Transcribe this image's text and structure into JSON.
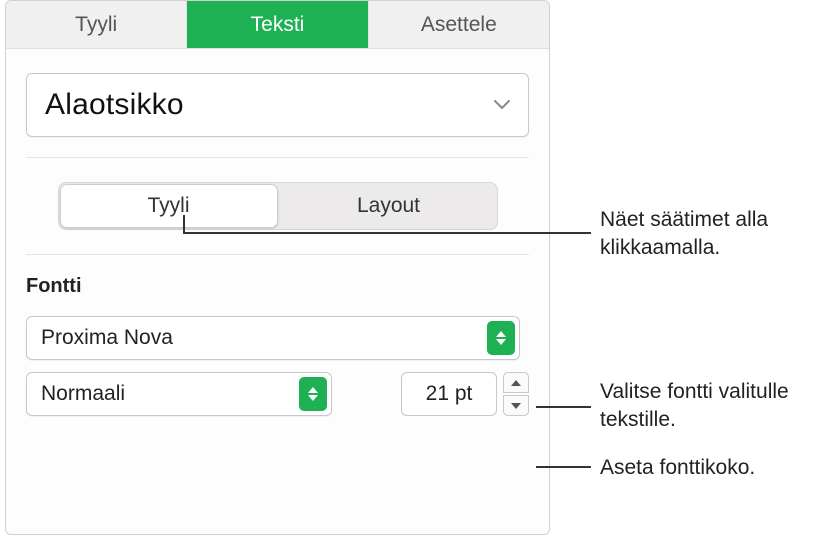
{
  "topTabs": {
    "style": "Tyyli",
    "text": "Teksti",
    "arrange": "Asettele"
  },
  "paragraphStyle": {
    "selected": "Alaotsikko"
  },
  "subTabs": {
    "style": "Tyyli",
    "layout": "Layout"
  },
  "fontSection": {
    "label": "Fontti",
    "family": "Proxima Nova",
    "styleName": "Normaali",
    "size": "21 pt"
  },
  "callouts": {
    "segmented": "Näet säätimet alla klikkaamalla.",
    "fontFamily": "Valitse fontti valitulle tekstille.",
    "fontSize": "Aseta fonttikoko."
  }
}
